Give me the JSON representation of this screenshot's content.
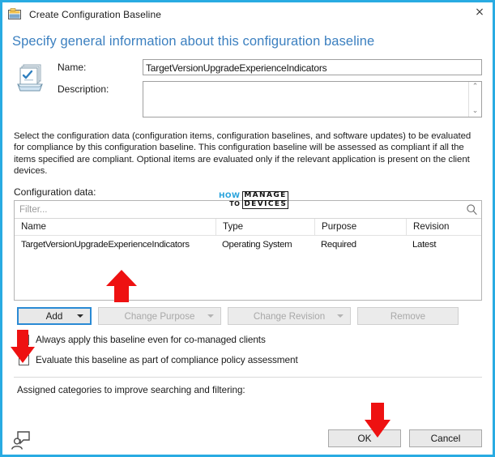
{
  "window": {
    "title": "Create Configuration Baseline",
    "icon": "configuration-baseline-window-icon",
    "close_label": "×"
  },
  "heading": "Specify general information about this configuration baseline",
  "form": {
    "icon": "configuration-baseline-icon",
    "name_label": "Name:",
    "name_value": "TargetVersionUpgradeExperienceIndicators",
    "description_label": "Description:",
    "description_value": "",
    "scroll_up": "⌃",
    "scroll_down": "⌄"
  },
  "paragraph": "Select the configuration data (configuration items, configuration baselines, and software updates) to be evaluated for compliance by this configuration baseline.  This configuration baseline will be assessed as compliant if all the items specified are compliant. Optional items are evaluated only if the relevant application is present on  the client devices.",
  "config_data": {
    "label": "Configuration data:",
    "filter_placeholder": "Filter...",
    "search_icon": "search-icon",
    "columns": [
      "Name",
      "Type",
      "Purpose",
      "Revision"
    ],
    "rows": [
      {
        "name": "TargetVersionUpgradeExperienceIndicators",
        "type": "Operating System",
        "purpose": "Required",
        "revision": "Latest"
      }
    ]
  },
  "actions": {
    "add": "Add",
    "change_purpose": "Change Purpose",
    "change_revision": "Change Revision",
    "remove": "Remove"
  },
  "checkboxes": [
    {
      "label": "Always apply this baseline even for co-managed clients",
      "checked": true
    },
    {
      "label": "Evaluate this baseline as part of compliance policy assessment",
      "checked": false
    }
  ],
  "assigned_categories_label": "Assigned categories to improve searching and filtering:",
  "footer": {
    "help_icon": "help-person-icon",
    "ok": "OK",
    "cancel": "Cancel"
  },
  "watermark": {
    "how": "HOW",
    "to": "TO",
    "manage": "MANAGE",
    "devices": "DEVICES"
  },
  "annotations": {
    "color": "#ee1111",
    "arrows": [
      {
        "name": "arrow-pointing-to-config-data-row",
        "direction": "up"
      },
      {
        "name": "arrow-pointing-to-always-apply-checkbox",
        "direction": "down"
      },
      {
        "name": "arrow-pointing-to-ok-button",
        "direction": "down"
      }
    ]
  },
  "colors": {
    "highlight_frame": "#29ABE2",
    "heading": "#3c80c0",
    "focus_border": "#2a8ad4"
  }
}
